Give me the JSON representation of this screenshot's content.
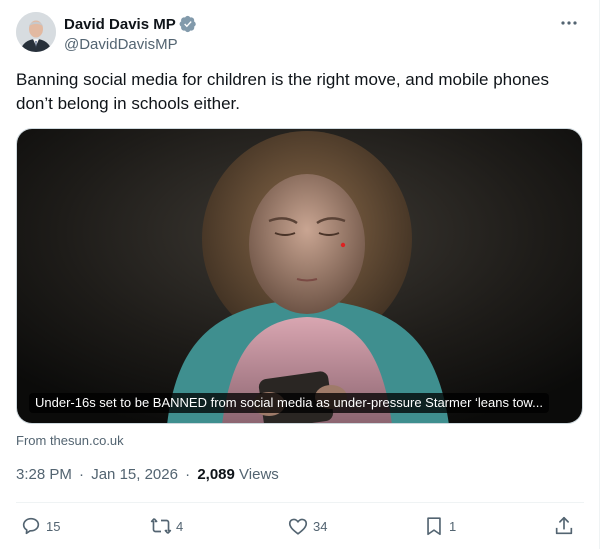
{
  "author": {
    "display_name": "David Davis MP",
    "handle": "@DavidDavisMP"
  },
  "tweet": {
    "text": "Banning social media for children is the right move, and mobile phones don’t belong in schools either."
  },
  "card": {
    "headline": "Under-16s set to be BANNED from social media as under-pressure Starmer ‘leans tow...",
    "source": "From thesun.co.uk"
  },
  "meta": {
    "time": "3:28 PM",
    "date": "Jan 15, 2026",
    "separator": "·",
    "views_count": "2,089",
    "views_label": "Views"
  },
  "actions": {
    "replies": "15",
    "reposts": "4",
    "likes": "34",
    "bookmarks": "1"
  },
  "colors": {
    "verified": "#829aab",
    "text": "#0f1419",
    "secondary": "#536471",
    "border": "#cfd9de"
  },
  "icons": [
    "verified-badge-icon",
    "more-icon",
    "reply-icon",
    "repost-icon",
    "like-icon",
    "bookmark-icon",
    "share-icon"
  ]
}
